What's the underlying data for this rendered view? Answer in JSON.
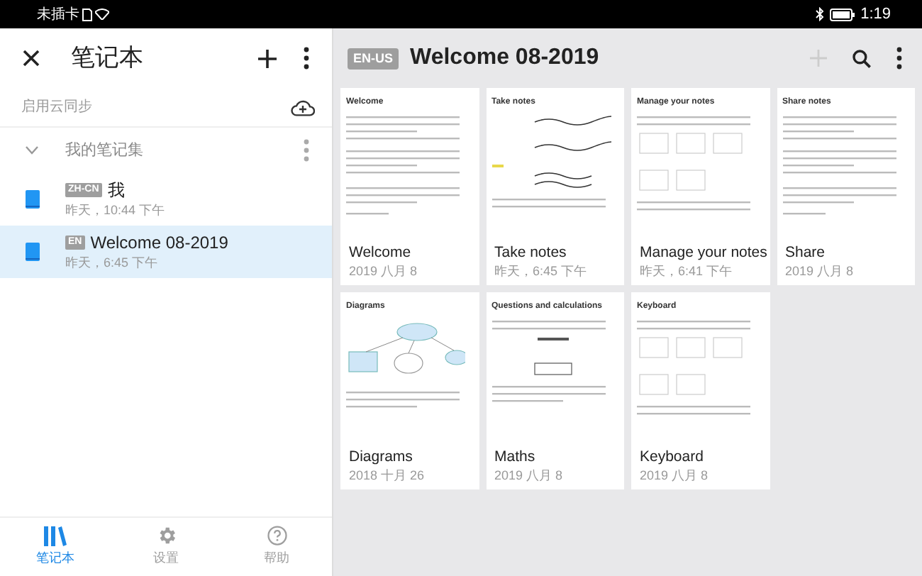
{
  "status_bar": {
    "carrier": "未插卡",
    "time": "1:19"
  },
  "sidebar": {
    "title": "笔记本",
    "sync_label": "启用云同步",
    "group": {
      "label": "我的笔记集",
      "expanded": true
    },
    "notebooks": [
      {
        "lang": "ZH-CN",
        "name": "我",
        "date": "昨天，10:44 下午",
        "selected": false
      },
      {
        "lang": "EN",
        "name": "Welcome 08-2019",
        "date": "昨天，6:45 下午",
        "selected": true
      }
    ]
  },
  "bottom_nav": [
    {
      "label": "笔记本",
      "kind": "books",
      "selected": true
    },
    {
      "label": "设置",
      "kind": "gear",
      "selected": false
    },
    {
      "label": "帮助",
      "kind": "help",
      "selected": false
    }
  ],
  "notebook": {
    "lang": "EN-US",
    "title": "Welcome 08-2019",
    "add_disabled": true
  },
  "pages": [
    {
      "preview_title": "Welcome",
      "kind": "text",
      "title": "Welcome",
      "date": "2019 八月 8"
    },
    {
      "preview_title": "Take notes",
      "kind": "handwriting",
      "title": "Take notes",
      "date": "昨天，6:45 下午"
    },
    {
      "preview_title": "Manage your notes",
      "kind": "layout",
      "title": "Manage your notes",
      "date": "昨天，6:41 下午"
    },
    {
      "preview_title": "Share notes",
      "kind": "text",
      "title": "Share",
      "date": "2019 八月 8"
    },
    {
      "preview_title": "Diagrams",
      "kind": "diagram",
      "title": "Diagrams",
      "date": "2018 十月 26"
    },
    {
      "preview_title": "Questions and calculations",
      "kind": "math",
      "title": "Maths",
      "date": "2019 八月 8"
    },
    {
      "preview_title": "Keyboard",
      "kind": "layout",
      "title": "Keyboard",
      "date": "2019 八月 8"
    }
  ]
}
